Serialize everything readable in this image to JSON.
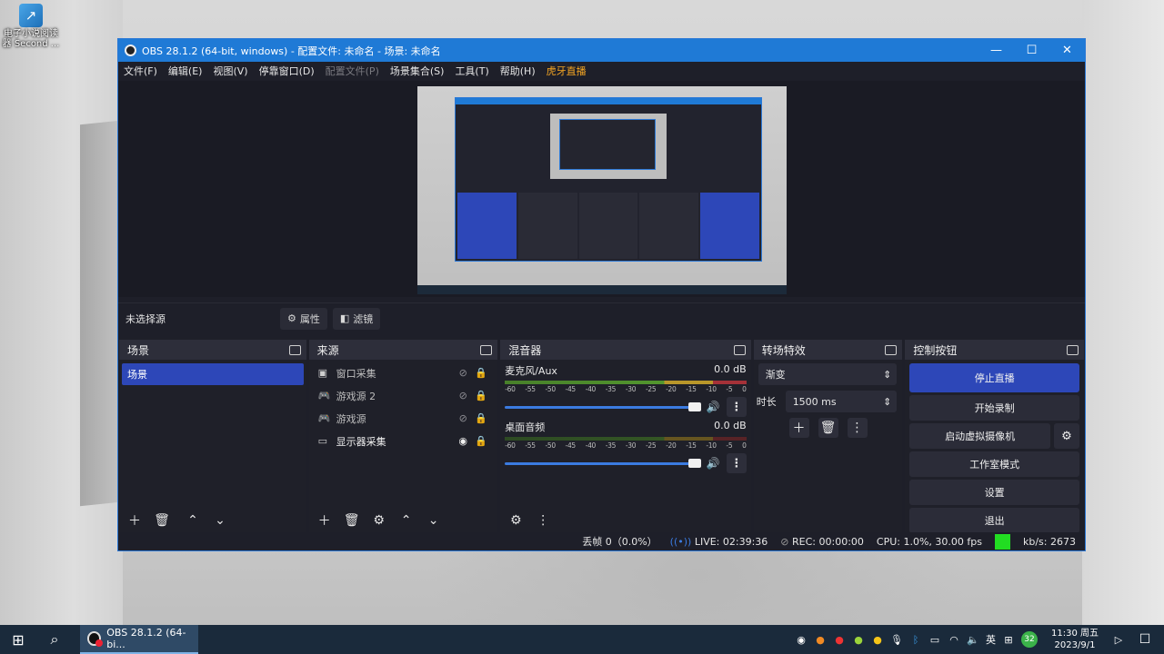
{
  "desktop": {
    "icon_label": "电子小说阅读器 Second ..."
  },
  "window": {
    "title": "OBS 28.1.2 (64-bit, windows) - 配置文件: 未命名 - 场景: 未命名",
    "controls": {
      "minimize": "—",
      "maximize": "☐",
      "close": "✕"
    }
  },
  "menu": [
    {
      "label": "文件(F)",
      "state": "normal"
    },
    {
      "label": "编辑(E)",
      "state": "normal"
    },
    {
      "label": "视图(V)",
      "state": "normal"
    },
    {
      "label": "停靠窗口(D)",
      "state": "normal"
    },
    {
      "label": "配置文件(P)",
      "state": "disabled"
    },
    {
      "label": "场景集合(S)",
      "state": "normal"
    },
    {
      "label": "工具(T)",
      "state": "normal"
    },
    {
      "label": "帮助(H)",
      "state": "normal"
    },
    {
      "label": "虎牙直播",
      "state": "accent"
    }
  ],
  "source_bar": {
    "no_source": "未选择源",
    "properties": "属性",
    "filters": "滤镜"
  },
  "scenes": {
    "title": "场景",
    "items": [
      "场景"
    ]
  },
  "sources": {
    "title": "来源",
    "items": [
      {
        "icon": "window-capture-icon",
        "glyph": "▣",
        "name": "窗口采集",
        "visible": false
      },
      {
        "icon": "gamepad-icon",
        "glyph": "🎮",
        "name": "游戏源 2",
        "visible": false
      },
      {
        "icon": "gamepad-icon",
        "glyph": "🎮",
        "name": "游戏源",
        "visible": false
      },
      {
        "icon": "monitor-icon",
        "glyph": "▭",
        "name": "显示器采集",
        "visible": true
      }
    ]
  },
  "mixer": {
    "title": "混音器",
    "channels": [
      {
        "name": "麦克风/Aux",
        "db": "0.0 dB",
        "active": true
      },
      {
        "name": "桌面音频",
        "db": "0.0 dB",
        "active": false
      }
    ],
    "ticks": [
      "-60",
      "-55",
      "-50",
      "-45",
      "-40",
      "-35",
      "-30",
      "-25",
      "-20",
      "-15",
      "-10",
      "-5",
      "0"
    ]
  },
  "transitions": {
    "title": "转场特效",
    "selected": "渐变",
    "duration_label": "时长",
    "duration": "1500 ms"
  },
  "controls": {
    "title": "控制按钮",
    "stop_stream": "停止直播",
    "start_record": "开始录制",
    "virtual_cam": "启动虚拟摄像机",
    "studio_mode": "工作室模式",
    "settings": "设置",
    "exit": "退出"
  },
  "status": {
    "dropped": "丢帧 0（0.0%）",
    "live": "LIVE: 02:39:36",
    "rec": "REC: 00:00:00",
    "cpu": "CPU: 1.0%, 30.00 fps",
    "kbps": "kb/s: 2673"
  },
  "taskbar": {
    "app_label": "OBS 28.1.2 (64-bi...",
    "ime": "英",
    "badge": "32",
    "time": "11:30 周五",
    "date": "2023/9/1"
  },
  "colors": {
    "accent": "#2d47b8",
    "titlebar": "#1f7ad6",
    "stream_ok": "#22dd22",
    "menu_accent": "#f5a623"
  }
}
